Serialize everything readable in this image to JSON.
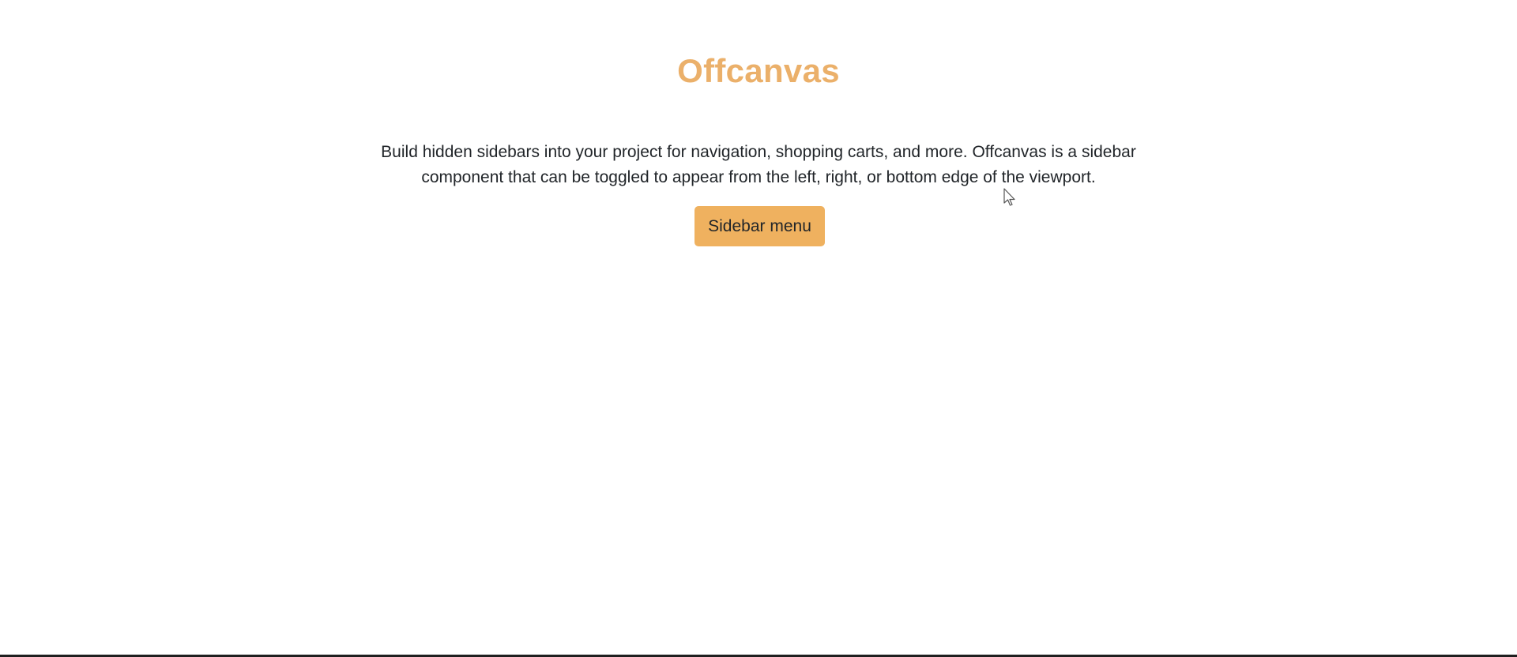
{
  "colors": {
    "accent": "#efb15f",
    "title": "#ebb06a",
    "text": "#212529",
    "background": "#ffffff"
  },
  "hero": {
    "title": "Offcanvas",
    "description": "Build hidden sidebars into your project for navigation, shopping carts, and more. Offcanvas is a sidebar component that can be toggled to appear from the left, right, or bottom edge of the viewport.",
    "button_label": "Sidebar menu"
  },
  "icons": {
    "cursor": "mouse-pointer-icon"
  }
}
